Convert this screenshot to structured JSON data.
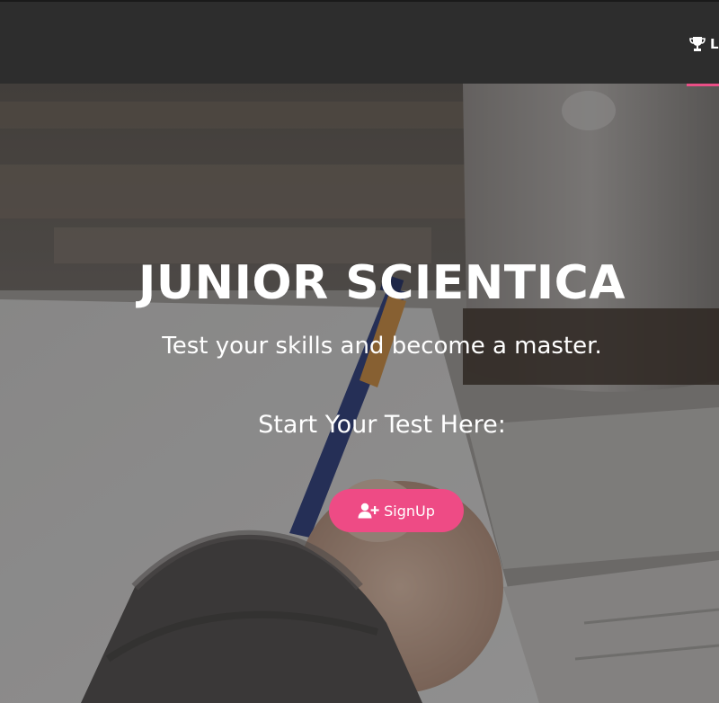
{
  "navbar": {
    "item_label": "L",
    "item_icon": "trophy-icon",
    "accent_color": "#e94f86"
  },
  "hero": {
    "title": "JUNIOR SCIENTICA",
    "subtitle": "Test your skills and become a master.",
    "start_text": "Start Your Test Here:",
    "signup_button": {
      "label": "SignUp",
      "icon": "user-plus-icon",
      "color": "#ee4b85"
    }
  }
}
